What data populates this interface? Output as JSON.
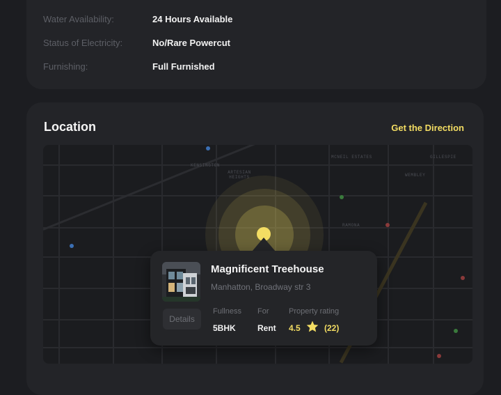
{
  "details": [
    {
      "label": "Water Availability:",
      "value": "24 Hours Available"
    },
    {
      "label": "Status of Electricity:",
      "value": "No/Rare Powercut"
    },
    {
      "label": "Furnishing:",
      "value": "Full Furnished"
    }
  ],
  "location": {
    "title": "Location",
    "direction_link": "Get the Direction"
  },
  "map": {
    "street_labels": [
      "KENSINGTON",
      "ARTESIAN HEIGHTS",
      "MCNEIL ESTATES",
      "GILLESPIE",
      "RAMONA",
      "WEMBLEY"
    ]
  },
  "property": {
    "name": "Magnificent Treehouse",
    "address": "Manhatton, Broadway str 3",
    "details_button": "Details",
    "fullness_label": "Fullness",
    "fullness_value": "5BHK",
    "for_label": "For",
    "for_value": "Rent",
    "rating_label": "Property rating",
    "rating": "4.5",
    "rating_count": "(22)",
    "star_icon": "star-icon"
  },
  "colors": {
    "accent": "#f3dd63",
    "background": "#1c1d21",
    "card": "#232428"
  }
}
